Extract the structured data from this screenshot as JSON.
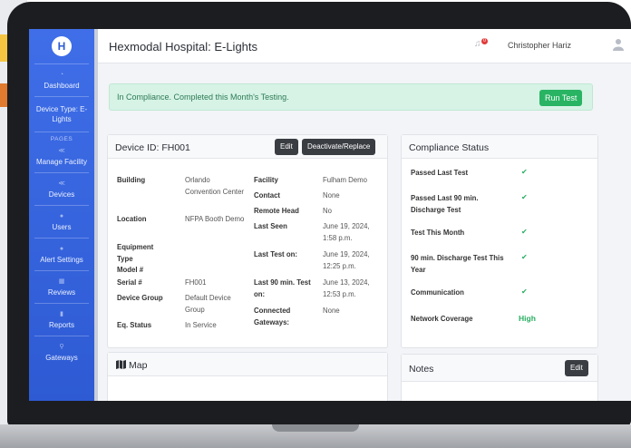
{
  "sidebar": {
    "logo": "H",
    "items": [
      {
        "label": "Dashboard",
        "icon": "dashboard-icon"
      },
      {
        "label": "Device Type: E-Lights",
        "icon": ""
      },
      {
        "label": "Manage Facility",
        "icon": "share-icon"
      },
      {
        "label": "Devices",
        "icon": "share-icon"
      },
      {
        "label": "Users",
        "icon": "user-icon"
      },
      {
        "label": "Alert Settings",
        "icon": "user-icon"
      },
      {
        "label": "Reviews",
        "icon": "calendar-icon"
      },
      {
        "label": "Reports",
        "icon": "chart-icon"
      },
      {
        "label": "Gateways",
        "icon": "pin-icon"
      }
    ],
    "section_heading": "PAGES"
  },
  "header": {
    "title": "Hexmodal Hospital: E-Lights",
    "notification_count": "0",
    "user_name": "Christopher Hariz"
  },
  "alert": {
    "message": "In Compliance. Completed this Month's Testing.",
    "button": "Run Test"
  },
  "device": {
    "title": "Device ID: FH001",
    "edit_button": "Edit",
    "deactivate_button": "Deactivate/Replace",
    "left_fields": [
      {
        "label": "Building",
        "value": "Orlando Convention Center"
      },
      {
        "label": "Location",
        "value": "NFPA Booth Demo"
      },
      {
        "label": "Equipment Type",
        "value": ""
      },
      {
        "label": "Model #",
        "value": ""
      },
      {
        "label": "Serial #",
        "value": "FH001"
      },
      {
        "label": "Device Group",
        "value": "Default Device Group"
      },
      {
        "label": "Eq. Status",
        "value": "In Service"
      }
    ],
    "right_fields": [
      {
        "label": "Facility",
        "value": "Fulham Demo"
      },
      {
        "label": "Contact",
        "value": "None"
      },
      {
        "label": "Remote Head",
        "value": "No"
      },
      {
        "label": "Last Seen",
        "value": "June 19, 2024, 1:58 p.m."
      },
      {
        "label": "Last Test on:",
        "value": "June 19, 2024, 12:25 p.m."
      },
      {
        "label": "Last 90 min. Test on:",
        "value": "June 13, 2024, 12:53 p.m."
      },
      {
        "label": "Connected Gateways:",
        "value": "None"
      }
    ]
  },
  "compliance": {
    "title": "Compliance Status",
    "rows": [
      {
        "label": "Passed Last Test",
        "status": "✔"
      },
      {
        "label": "Passed Last 90 min. Discharge Test",
        "status": "✔"
      },
      {
        "label": "Test This Month",
        "status": "✔"
      },
      {
        "label": "90 min. Discharge Test This Year",
        "status": "✔"
      },
      {
        "label": "Communication",
        "status": "✔"
      },
      {
        "label": "Network Coverage",
        "status": "High"
      }
    ]
  },
  "map": {
    "title": "Map"
  },
  "notes": {
    "title": "Notes",
    "edit_button": "Edit"
  },
  "colors": {
    "sidebar": "#3f6ee8",
    "success": "#28b463",
    "alert_bg": "#d6f3e6"
  }
}
